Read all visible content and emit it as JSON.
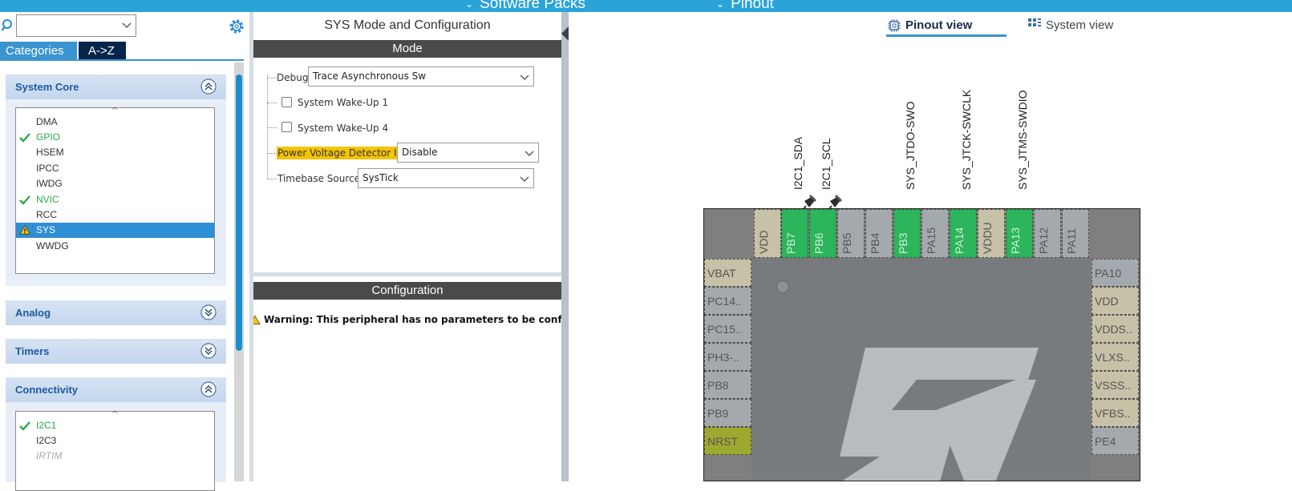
{
  "topbar": {
    "menu_software_packs": "Software Packs",
    "menu_pinout": "Pinout"
  },
  "left": {
    "search": {
      "value": ""
    },
    "tabs": {
      "categories": "Categories",
      "az": "A->Z"
    },
    "system_core": {
      "title": "System Core",
      "items": [
        {
          "label": "DMA",
          "state": "none"
        },
        {
          "label": "GPIO",
          "state": "ok"
        },
        {
          "label": "HSEM",
          "state": "none"
        },
        {
          "label": "IPCC",
          "state": "none"
        },
        {
          "label": "IWDG",
          "state": "none"
        },
        {
          "label": "NVIC",
          "state": "ok"
        },
        {
          "label": "RCC",
          "state": "none"
        },
        {
          "label": "SYS",
          "state": "warning",
          "selected": true
        },
        {
          "label": "WWDG",
          "state": "none"
        }
      ]
    },
    "analog": {
      "title": "Analog"
    },
    "timers": {
      "title": "Timers"
    },
    "connectivity": {
      "title": "Connectivity",
      "items": [
        {
          "label": "I2C1",
          "state": "ok"
        },
        {
          "label": "I2C3",
          "state": "none"
        },
        {
          "label": "IRTIM",
          "state": "disabled"
        }
      ]
    }
  },
  "mid": {
    "title": "SYS Mode and Configuration",
    "mode_header": "Mode",
    "debug_label": "Debug",
    "debug_value": "Trace Asynchronous Sw",
    "wakeup1_label": "System Wake-Up 1",
    "wakeup4_label": "System Wake-Up 4",
    "pvd_label": "Power Voltage Detector In",
    "pvd_value": "Disable",
    "timebase_label": "Timebase Source",
    "timebase_value": "SysTick",
    "config_header": "Configuration",
    "warning": "Warning: This peripheral has no parameters to be configured"
  },
  "right": {
    "tab_pinout": "Pinout view",
    "tab_system": "System view",
    "pin_labels": {
      "i2c_sda": "I2C1_SDA",
      "i2c_scl": "I2C1_SCL",
      "swo": "SYS_JTDO-SWO",
      "swclk": "SYS_JTCK-SWCLK",
      "swdio": "SYS_JTMS-SWDIO"
    },
    "top_pins": [
      "VDD",
      "PB7",
      "PB6",
      "PB5",
      "PB4",
      "PB3",
      "PA15",
      "PA14",
      "VDDU",
      "PA13",
      "PA12",
      "PA11"
    ],
    "left_pins": [
      "VBAT",
      "PC14..",
      "PC15..",
      "PH3-..",
      "PB8",
      "PB9",
      "NRST"
    ],
    "right_pins": [
      "PA10",
      "VDD",
      "VDDS..",
      "VLXS..",
      "VSSS..",
      "VFBS..",
      "PE4"
    ]
  },
  "colors": {
    "accent": "#2aa3d9",
    "pin_green": "#2cb55a",
    "pin_beige": "#c7c1a7",
    "pin_gray": "#a4a9ae",
    "pin_olive": "#9ea82e",
    "highlight": "#f5c400"
  }
}
